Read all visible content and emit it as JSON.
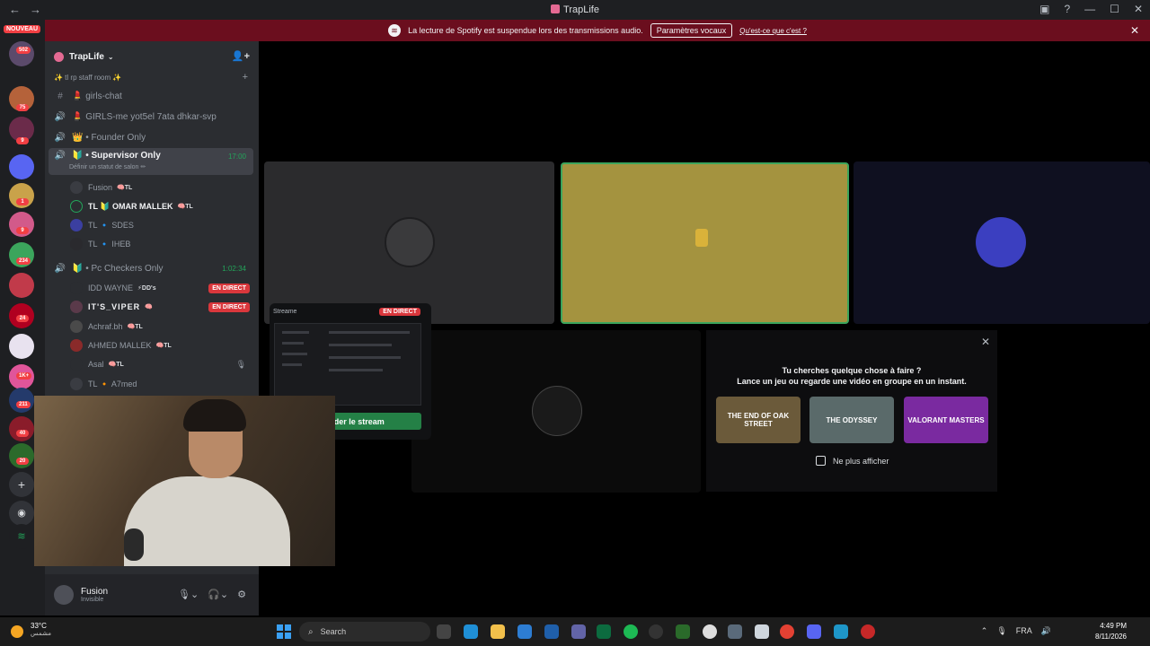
{
  "window": {
    "title": "TrapLife"
  },
  "banner": {
    "message": "La lecture de Spotify est suspendue lors des transmissions audio.",
    "button": "Paramètres vocaux",
    "link": "Qu'est-ce que c'est ?"
  },
  "servers": {
    "new_label": "NOUVEAU",
    "badges": [
      "502",
      "75",
      "9",
      "1",
      "9",
      "234",
      "24",
      "1K+",
      "211",
      "40",
      "20"
    ]
  },
  "guild": {
    "name": "TrapLife"
  },
  "category": {
    "name": "✨ tl rp staff room ✨"
  },
  "channels": [
    {
      "name": "💄 girls-chat",
      "icon": "#"
    },
    {
      "name": "💄 GIRLS-me yot5el 7ata dhkar-svp",
      "icon": "🔊"
    },
    {
      "name": "👑 • Founder Only",
      "icon": "🔊"
    },
    {
      "name": "🔰 • Supervisor Only",
      "icon": "🔊",
      "status": "Définir un statut de salon ✏",
      "time": "17:00"
    },
    {
      "name": "🔰 • Pc Checkers Only",
      "icon": "🔊",
      "time": "1:02:34"
    }
  ],
  "supervisor_members": [
    {
      "name": "Fusion",
      "tag": "🧠TL"
    },
    {
      "name": "TL 🔰 OMAR MALLEK",
      "tag": "🧠TL"
    },
    {
      "name": "TL 🔹 SDES",
      "tag": ""
    },
    {
      "name": "TL 🔹 IHEB",
      "tag": ""
    }
  ],
  "checker_members": [
    {
      "name": "IDD WAYNE",
      "tag": "⚡DD's",
      "live": "EN DIRECT"
    },
    {
      "name": "IT'S_VIPER",
      "tag": "🧠",
      "live": "EN DIRECT"
    },
    {
      "name": "Achraf.bh",
      "tag": "🧠TL",
      "live": ""
    },
    {
      "name": "AHMED MALLEK",
      "tag": "🧠TL",
      "live": ""
    },
    {
      "name": "Asal",
      "tag": "🧠TL",
      "live": ""
    },
    {
      "name": "TL 🔸 A7med",
      "tag": "",
      "live": ""
    }
  ],
  "user": {
    "name": "Fusion",
    "status": "Invisible"
  },
  "stream_popup": {
    "label": "Streame",
    "live": "EN DIRECT",
    "watch": "Regarder le stream"
  },
  "activity": {
    "line1": "Tu cherches quelque chose à faire ?",
    "line2": "Lance un jeu ou regarde une vidéo en groupe en un instant.",
    "games": [
      "THE END OF OAK STREET",
      "THE ODYSSEY",
      "VALORANT MASTERS"
    ],
    "dont_show": "Ne plus afficher"
  },
  "taskbar": {
    "temp": "33°C",
    "weather": "مشمس",
    "search": "Search",
    "lang": "FRA",
    "time": "4:49 PM",
    "date": "8/11/2026"
  },
  "colors": {
    "accent": "#23a55a",
    "danger": "#da373c",
    "banner": "#6b0e1e",
    "highlight_tile": "#a4933f"
  }
}
